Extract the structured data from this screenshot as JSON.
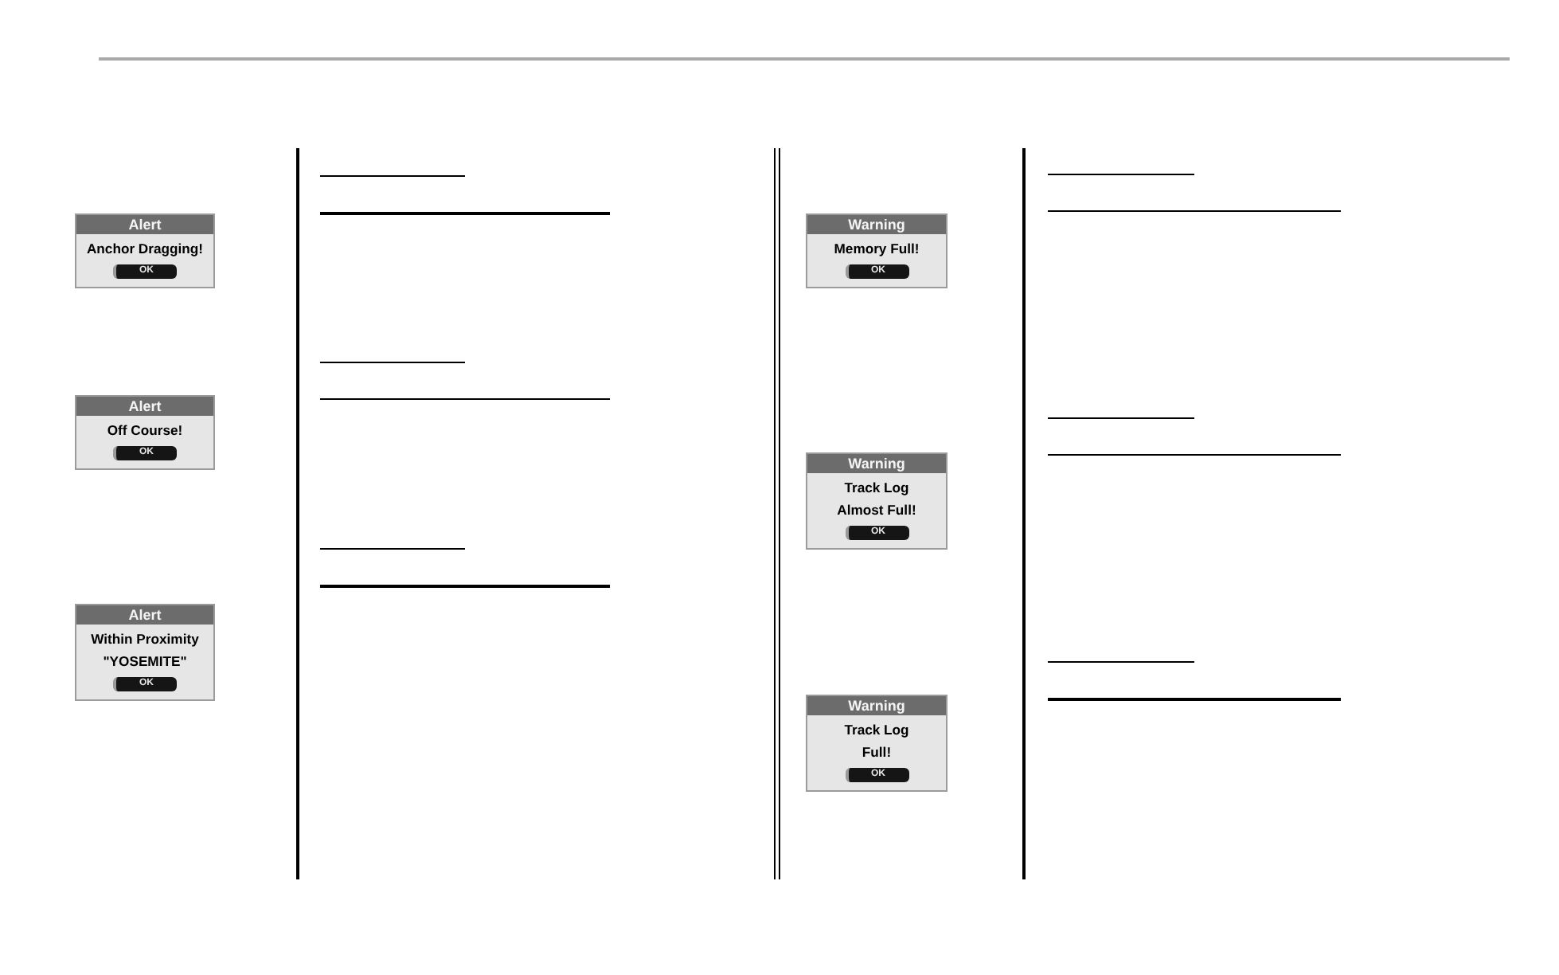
{
  "columns": [
    {
      "dialogs": [
        {
          "title": "Alert",
          "message_lines": [
            "Anchor Dragging!"
          ],
          "button": "OK"
        },
        {
          "title": "Alert",
          "message_lines": [
            "Off Course!"
          ],
          "button": "OK"
        },
        {
          "title": "Alert",
          "message_lines": [
            "Within Proximity",
            "\"YOSEMITE\""
          ],
          "button": "OK"
        }
      ]
    },
    {
      "dialogs": [
        {
          "title": "Warning",
          "message_lines": [
            "Memory Full!"
          ],
          "button": "OK"
        },
        {
          "title": "Warning",
          "message_lines": [
            "Track Log",
            "Almost Full!"
          ],
          "button": "OK"
        },
        {
          "title": "Warning",
          "message_lines": [
            "Track Log",
            "Full!"
          ],
          "button": "OK"
        }
      ]
    }
  ]
}
